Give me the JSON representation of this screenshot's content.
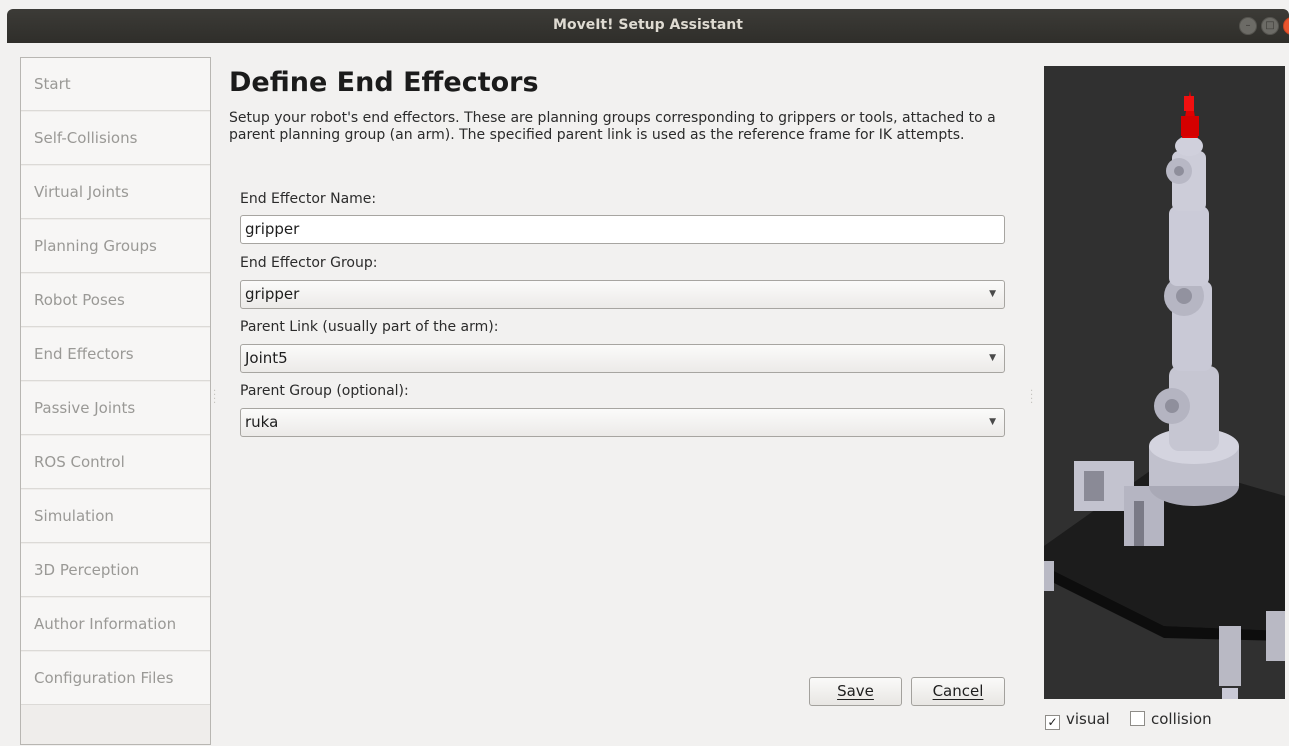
{
  "window": {
    "title": "MoveIt! Setup Assistant",
    "controls": {
      "minimize_icon": "minimize-icon",
      "maximize_icon": "maximize-icon",
      "close_icon": "close-icon"
    }
  },
  "sidebar": {
    "items": [
      {
        "label": "Start"
      },
      {
        "label": "Self-Collisions"
      },
      {
        "label": "Virtual Joints"
      },
      {
        "label": "Planning Groups"
      },
      {
        "label": "Robot Poses"
      },
      {
        "label": "End Effectors"
      },
      {
        "label": "Passive Joints"
      },
      {
        "label": "ROS Control"
      },
      {
        "label": "Simulation"
      },
      {
        "label": "3D Perception"
      },
      {
        "label": "Author Information"
      },
      {
        "label": "Configuration Files"
      }
    ]
  },
  "main": {
    "title": "Define End Effectors",
    "description": "Setup your robot's end effectors. These are planning groups corresponding to grippers or tools, attached to a parent planning group (an arm). The specified parent link is used as the reference frame for IK attempts.",
    "fields": {
      "name_label": "End Effector Name:",
      "name_value": "gripper",
      "group_label": "End Effector Group:",
      "group_value": "gripper",
      "parent_link_label": "Parent Link (usually part of the arm):",
      "parent_link_value": "Joint5",
      "parent_group_label": "Parent Group (optional):",
      "parent_group_value": "ruka"
    },
    "buttons": {
      "save": "Save",
      "cancel": "Cancel"
    }
  },
  "viewer": {
    "visual_label": "visual",
    "visual_checked": true,
    "collision_label": "collision",
    "collision_checked": false,
    "checkmark": "✓"
  },
  "colors": {
    "titlebar": "#3c3b37",
    "viewport_bg": "#303030",
    "end_effector_highlight": "#e00000",
    "robot_body": "#c9c9d6",
    "platform": "#1a1a1a"
  }
}
